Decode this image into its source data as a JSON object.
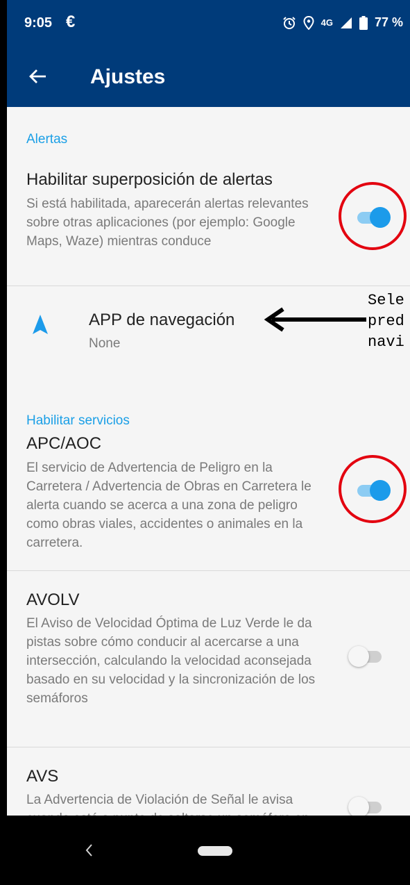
{
  "status_bar": {
    "time": "9:05",
    "notif_icon_text": "€",
    "network": "4G",
    "battery": "77 %"
  },
  "app_bar": {
    "title": "Ajustes"
  },
  "sections": {
    "alerts": "Alertas",
    "services": "Habilitar servicios"
  },
  "settings": {
    "overlay": {
      "title": "Habilitar superposición de alertas",
      "desc": "Si está habilitada, aparecerán alertas relevantes sobre otras aplicaciones (por ejemplo: Google Maps, Waze) mientras conduce",
      "enabled": true
    },
    "nav_app": {
      "title": "APP de navegación",
      "value": "None"
    },
    "apc": {
      "title": "APC/AOC",
      "desc": "El servicio de Advertencia de Peligro en la Carretera / Advertencia de Obras en Carretera le alerta cuando se acerca a una zona de peligro como obras viales, accidentes o animales en la carretera.",
      "enabled": true
    },
    "avolv": {
      "title": "AVOLV",
      "desc": "El Aviso de Velocidad Óptima de Luz Verde le da pistas sobre cómo conducir al acercarse a una intersección, calculando la velocidad aconsejada basado en su velocidad y la sincronización de los semáforos",
      "enabled": false
    },
    "avs": {
      "title": "AVS",
      "desc": "La Advertencia de Violación de Señal le avisa cuando está a punto de saltarse un semáforo en rojo",
      "enabled": false
    }
  },
  "annotation": {
    "line1": "Sele",
    "line2": "pred",
    "line3": "navi"
  },
  "colors": {
    "app_bar": "#003b7a",
    "accent": "#1c9bea",
    "annotation_red": "#e3000f"
  }
}
